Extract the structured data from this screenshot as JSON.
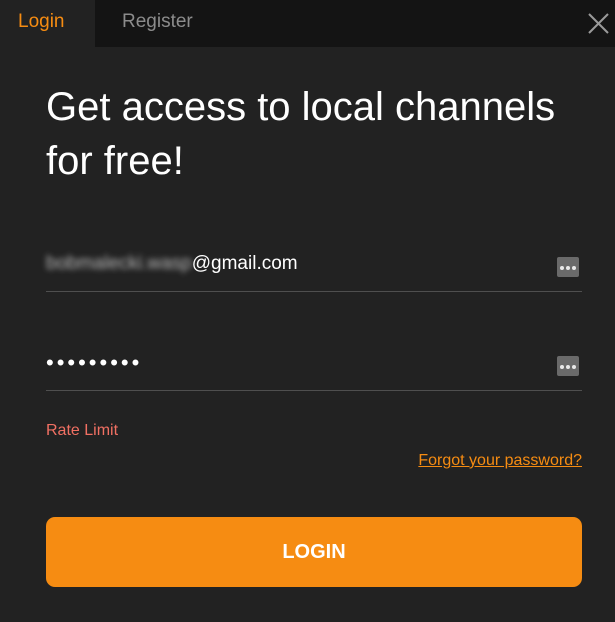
{
  "tabs": {
    "login": "Login",
    "register": "Register"
  },
  "title": "Get access to local channels for free!",
  "email": {
    "obscured_part": "bobmalecki.wasp",
    "domain_part": "@gmail.com"
  },
  "password": {
    "masked_value": "•••••••••"
  },
  "error_text": "Rate Limit",
  "forgot_link": "Forgot your password?",
  "login_button": "LOGIN",
  "colors": {
    "accent": "#f68c12",
    "background": "#222222",
    "tab_bar": "#141414",
    "error": "#f17063"
  },
  "icons": {
    "close": "close-icon",
    "field_menu": "dots-menu-icon"
  }
}
